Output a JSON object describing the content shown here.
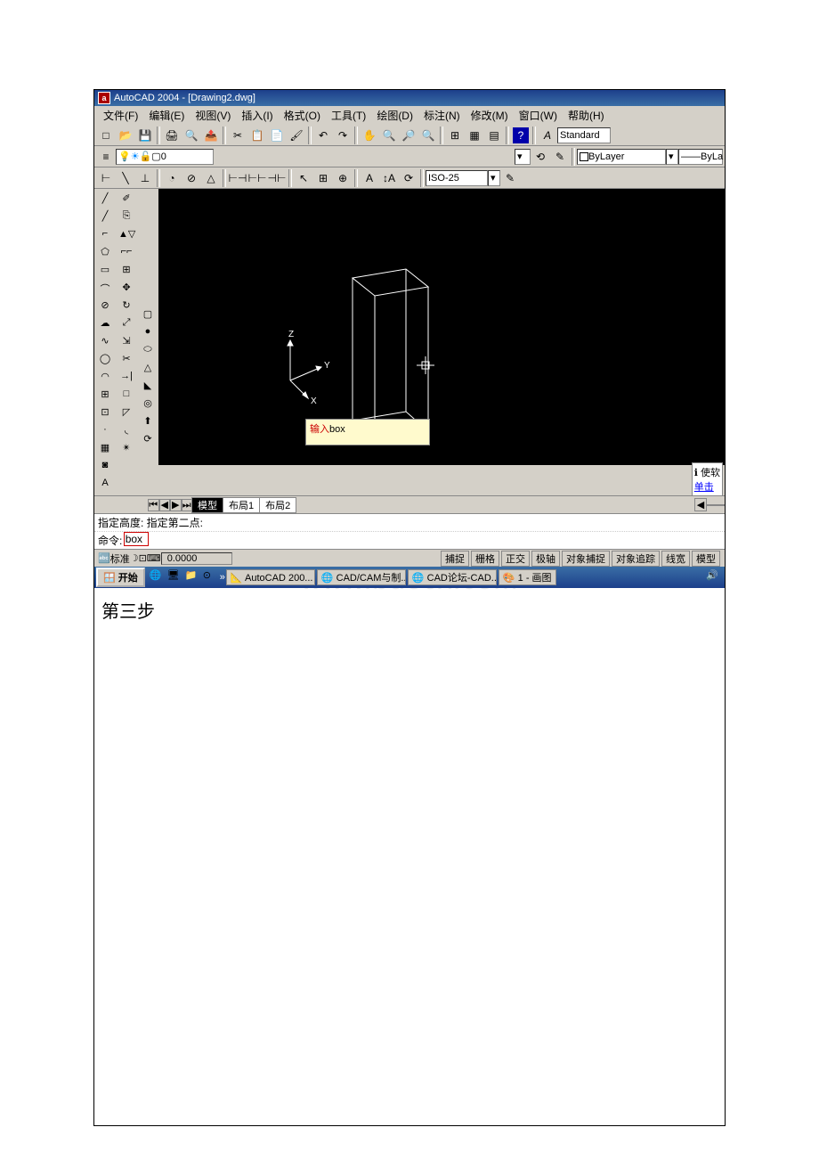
{
  "title": "AutoCAD 2004 - [Drawing2.dwg]",
  "app_icon_letter": "a",
  "menu": {
    "file": "文件(F)",
    "edit": "编辑(E)",
    "view": "视图(V)",
    "insert": "插入(I)",
    "format": "格式(O)",
    "tools": "工具(T)",
    "draw": "绘图(D)",
    "dimension": "标注(N)",
    "modify": "修改(M)",
    "window": "窗口(W)",
    "help": "帮助(H)"
  },
  "style_dropdown": "Standard",
  "layer_zero": "0",
  "layer_dropdown": "ByLayer",
  "lineweight": "ByLa",
  "dim_style": "ISO-25",
  "tooltip_prefix": "输入",
  "tooltip_cmd": "box",
  "tabs": {
    "model": "模型",
    "layout1": "布局1",
    "layout2": "布局2"
  },
  "cmd_history": "指定高度: 指定第二点:",
  "cmd_prompt": "命令:",
  "cmd_value": "box",
  "status": {
    "anno_left": "标准",
    "coords": "0.0000",
    "snap": "捕捉",
    "grid": "栅格",
    "ortho": "正交",
    "polar": "极轴",
    "osnap": "对象捕捉",
    "otrack": "对象追踪",
    "lwt": "线宽",
    "model": "模型"
  },
  "right_panel": {
    "soft": "使软",
    "click": "单击"
  },
  "taskbar": {
    "start": "开始",
    "task1": "AutoCAD 200...",
    "task2": "CAD/CAM与制...",
    "task3": "CAD论坛-CAD...",
    "task4": "1 - 画图"
  },
  "step_label": "第三步",
  "axes": {
    "x": "X",
    "y": "Y",
    "z": "Z"
  }
}
